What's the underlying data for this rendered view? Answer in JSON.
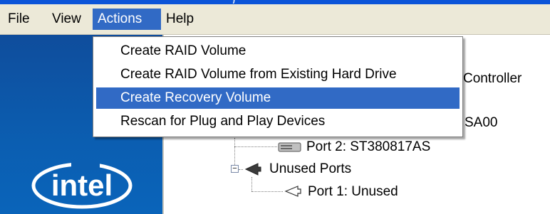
{
  "window": {
    "title_fragment": ")"
  },
  "menubar": {
    "items": [
      {
        "label": "File"
      },
      {
        "label": "View"
      },
      {
        "label": "Actions",
        "active": true
      },
      {
        "label": "Help"
      }
    ]
  },
  "actions_menu": {
    "items": [
      {
        "label": "Create RAID Volume"
      },
      {
        "label": "Create RAID Volume from Existing Hard Drive"
      },
      {
        "label": "Create Recovery Volume",
        "highlighted": true
      },
      {
        "label": "Rescan for Plug and Play Devices"
      }
    ]
  },
  "tree": {
    "controller_fragment": "Controller",
    "device_fragment": "SA00",
    "port2": "Port 2: ST380817AS",
    "unused_ports": "Unused Ports",
    "port1": "Port 1: Unused",
    "expander_symbol": "−"
  },
  "brand": {
    "logo_text": "intel",
    "logo_color": "#ffffff",
    "panel_color": "#0b5eb1"
  },
  "colors": {
    "selection": "#316ac5",
    "menubar_bg": "#ece9d8",
    "title_blue": "#0b54d8"
  }
}
